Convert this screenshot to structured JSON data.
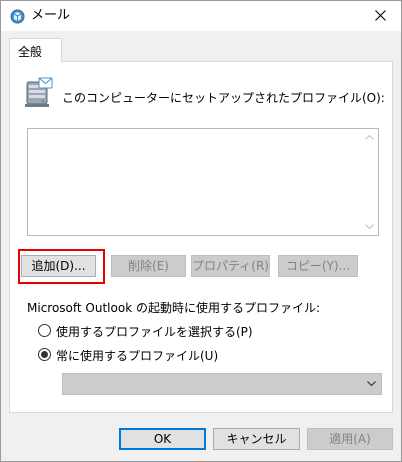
{
  "window": {
    "title": "メール",
    "title_icon": "mail-settings-icon",
    "close_icon": "close-icon"
  },
  "tabs": [
    {
      "label": "全般",
      "active": true
    }
  ],
  "profiles": {
    "icon": "profile-server-icon",
    "label": "このコンピューターにセットアップされたプロファイル(O):",
    "items": []
  },
  "actions": {
    "add_label": "追加(D)...",
    "delete_label": "削除(E)",
    "properties_label": "プロパティ(R)",
    "copy_label": "コピー(Y)..."
  },
  "startup": {
    "label": "Microsoft Outlook の起動時に使用するプロファイル:",
    "option_select": "使用するプロファイルを選択する(P)",
    "option_always": "常に使用するプロファイル(U)",
    "selected_option": "always",
    "profile_value": ""
  },
  "footer": {
    "ok_label": "OK",
    "cancel_label": "キャンセル",
    "apply_label": "適用(A)"
  },
  "colors": {
    "highlight_border": "#e60000",
    "focus_border": "#0078d7"
  }
}
